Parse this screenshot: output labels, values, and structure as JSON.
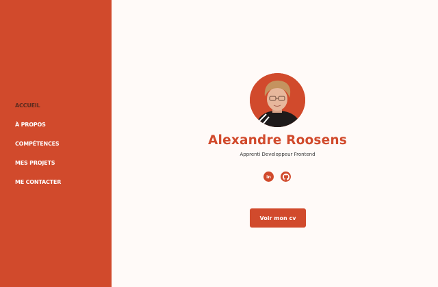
{
  "nav": {
    "items": [
      {
        "label": "ACCUEIL"
      },
      {
        "label": "À PROPOS"
      },
      {
        "label": "COMPÉTENCES"
      },
      {
        "label": "MES PROJETS"
      },
      {
        "label": "ME CONTACTER"
      }
    ],
    "active": "ACCUEIL"
  },
  "profile": {
    "name": "Alexandre Roosens",
    "subtitle": "Apprenti Developpeur Frontend",
    "avatar_icon": "profile-photo"
  },
  "socials": [
    {
      "icon": "linkedin-icon",
      "glyph": "in"
    },
    {
      "icon": "github-icon"
    }
  ],
  "cv_button": {
    "label": "Voir mon cv"
  },
  "colors": {
    "accent": "#d14a2c",
    "active_nav": "#5a2a1e",
    "background": "#fffaf8"
  }
}
